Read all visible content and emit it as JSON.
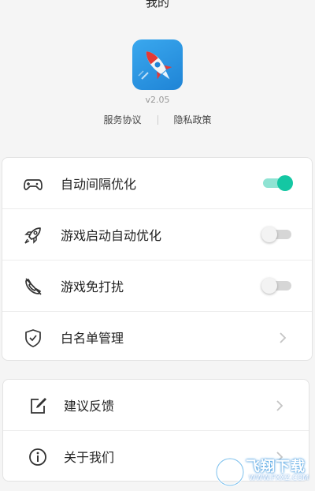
{
  "header": {
    "title": "我的"
  },
  "app": {
    "version": "v2.05"
  },
  "links": {
    "terms": "服务协议",
    "privacy": "隐私政策"
  },
  "settings": [
    {
      "label": "自动间隔优化",
      "icon": "gamepad-icon",
      "toggle": "on"
    },
    {
      "label": "游戏启动自动优化",
      "icon": "rocket-icon",
      "toggle": "off"
    },
    {
      "label": "游戏免打扰",
      "icon": "phone-off-icon",
      "toggle": "off"
    },
    {
      "label": "白名单管理",
      "icon": "shield-check-icon"
    }
  ],
  "other": [
    {
      "label": "建议反馈",
      "icon": "edit-icon"
    },
    {
      "label": "关于我们",
      "icon": "info-icon"
    }
  ],
  "watermark": {
    "text": "飞翔下载",
    "url": "WWW.FXXZ.COM"
  },
  "colors": {
    "accent": "#14c7a3",
    "app_icon_bg": "#2a93e2"
  }
}
